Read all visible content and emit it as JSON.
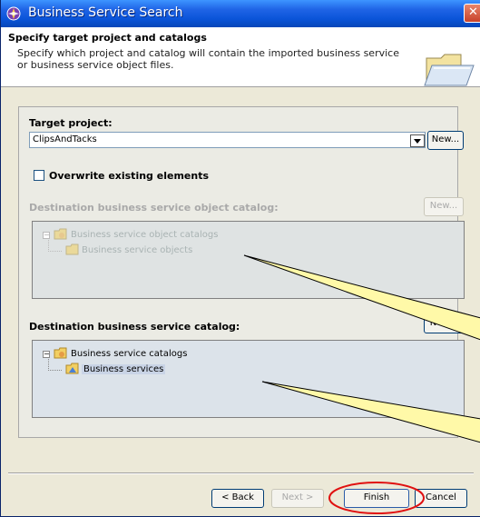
{
  "window": {
    "title": "Business Service Search",
    "close_glyph": "✕"
  },
  "header": {
    "title": "Specify target project and catalogs",
    "description": "Specify which project and catalog will contain the imported business service or business service object files."
  },
  "target_project": {
    "label": "Target project:",
    "value": "ClipsAndTacks",
    "new_label": "New..."
  },
  "overwrite": {
    "label": "Overwrite existing elements",
    "checked": false
  },
  "object_catalog": {
    "label": "Destination business service object catalog:",
    "new_label": "New...",
    "tree": {
      "root": "Business service object catalogs",
      "child": "Business service objects"
    }
  },
  "service_catalog": {
    "label": "Destination business service catalog:",
    "new_label": "New...",
    "tree": {
      "root": "Business service catalogs",
      "child": "Business services"
    }
  },
  "footer": {
    "back_label": "< Back",
    "next_label": "Next >",
    "finish_label": "Finish",
    "cancel_label": "Cancel"
  },
  "colors": {
    "titlebar": "#0a54d8",
    "annotation_fill": "#fff9a8",
    "highlight_ring": "#e01010"
  },
  "icons": [
    "app-icon",
    "close-icon",
    "folder-open-icon",
    "tree-folder-icon",
    "tree-leaf-icon",
    "dropdown-arrow-icon"
  ]
}
